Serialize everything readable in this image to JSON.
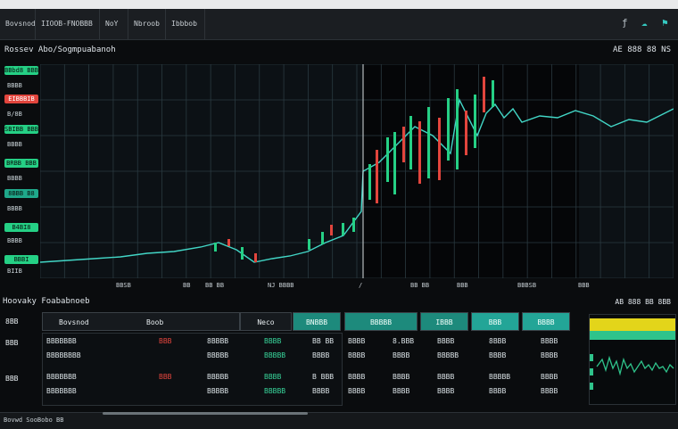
{
  "toolbar": {
    "tabs": [
      "Bovsnod",
      "IIOOB-FNOBBB",
      "NoY",
      "Nbroob",
      "Ibbbob"
    ],
    "icons": [
      "f-icon",
      "cloud-icon",
      "bookmark-icon"
    ]
  },
  "chart": {
    "title": "Rossev Abo/Sogmpuabanoh",
    "stats": "AE 888 88 NS",
    "left_panel": [
      {
        "label": "BBbd8 BBBB",
        "style": "green"
      },
      {
        "label": "EIBBBIB",
        "style": "red"
      },
      {
        "label": "SBIBB BBB",
        "style": "green"
      },
      {
        "label": "BRBB BBB",
        "style": "green"
      },
      {
        "label": "8BBB B8",
        "style": "teal"
      },
      {
        "label": "B4BI8",
        "style": "green"
      },
      {
        "label": "BBBI",
        "style": "green"
      }
    ],
    "left_values": [
      "BBBB",
      "B/8B",
      "BBBB",
      "BBBB",
      "BBBB",
      "BBBB",
      "BIIB"
    ],
    "x_labels": [
      "BBSB",
      "BB",
      "BB BB",
      "NJ BBBB",
      "/",
      "BB BB",
      "BBB",
      "BBBSB",
      "BBB"
    ]
  },
  "section": {
    "title": "Hoovaky Foababnoeb",
    "right_stats": "AB 888 BB 8BB"
  },
  "table": {
    "headers": [
      "Bovsnod",
      "Boob",
      "Neco",
      "BNBBB",
      "BBBBB",
      "IBBB",
      "BBB",
      "BBBB"
    ],
    "row_labels": [
      "8BB",
      "BBB",
      "BBB"
    ],
    "rows": [
      {
        "name": "BBBBBBB",
        "flag": "BBB",
        "c1": "8BBBB",
        "c2": "BBBB",
        "c3": "BB BB",
        "c4": "BBBB",
        "c5": "8.BBB",
        "c6": "BBBB",
        "c7": "8BBB",
        "c8": "BBBB"
      },
      {
        "name": "BBBBBBBB",
        "flag": "",
        "c1": "BBBBB",
        "c2": "BBBBB",
        "c3": "BBBB",
        "c4": "BBBB",
        "c5": "BBBB",
        "c6": "BBBBB",
        "c7": "BBBB",
        "c8": "BBBB"
      },
      {
        "name": "BBBBBBB",
        "flag": "BBB",
        "c1": "BBBBB",
        "c2": "BBBB",
        "c3": "B BBB",
        "c4": "BBBB",
        "c5": "BBBB",
        "c6": "BBBB",
        "c7": "BBBBB",
        "c8": "BBBB"
      },
      {
        "name": "BBBBBBB",
        "flag": "",
        "c1": "BBBBB",
        "c2": "BBBBB",
        "c3": "BBBB",
        "c4": "BBBB",
        "c5": "BBBB",
        "c6": "BBBB",
        "c7": "BBBB",
        "c8": "BBBB"
      }
    ]
  },
  "status": {
    "text": "Bovwd SooBobo BB"
  },
  "colors": {
    "up": "#25d085",
    "down": "#e2453d",
    "line": "#42d6c6",
    "grid": "#2a3a40"
  }
}
